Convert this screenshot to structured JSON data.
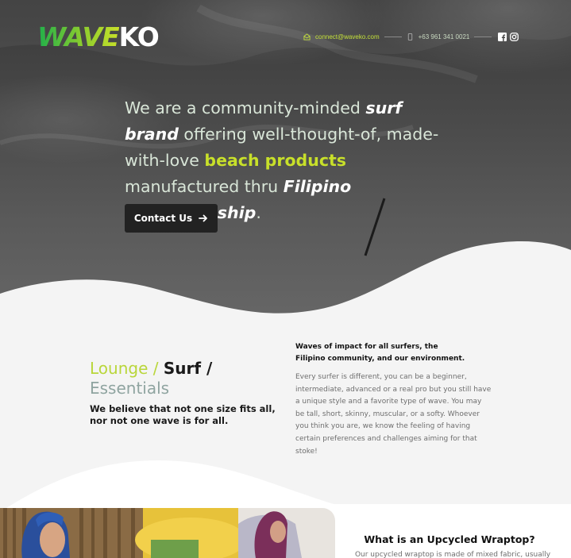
{
  "brand": {
    "logo_wave": "WAVE",
    "logo_ko": "KO"
  },
  "header": {
    "email": "connect@waveko.com",
    "phone": "+63 961 341 0021",
    "social": [
      "facebook-icon",
      "instagram-icon"
    ]
  },
  "hero": {
    "headline_1": "We are a community-minded ",
    "headline_em1": "surf brand",
    "headline_2": " offering well-thought-of, made-with-love ",
    "headline_em2": "beach products",
    "headline_3": " manufactured thru ",
    "headline_em3": "Filipino craftsmanship",
    "headline_4": ".",
    "cta_label": "Contact Us"
  },
  "categories": {
    "lounge": "Lounge / ",
    "surf": "Surf /",
    "essentials": "Essentials",
    "tagline": "We believe that not one size fits all, nor not one wave is for all."
  },
  "impact": {
    "title": "Waves of impact for all surfers, the Filipino community, and our environment.",
    "body": "Every surfer is different, you can be a beginner, intermediate, advanced or a real pro but you still have a unique style and a favorite type of wave. You may be tall, short, skinny, muscular, or a softy. Whoever you think you are, we know the feeling of having certain preferences and challenges aiming for that stoke!"
  },
  "wraptop": {
    "title": "What is an Upcycled Wraptop?",
    "body": "Our upcycled wraptop is made of mixed fabric, usually"
  },
  "colors": {
    "accent": "#c8e02a",
    "logo_green": "#1fb04a",
    "button_bg": "#222222",
    "background": "#f4f4f4"
  }
}
